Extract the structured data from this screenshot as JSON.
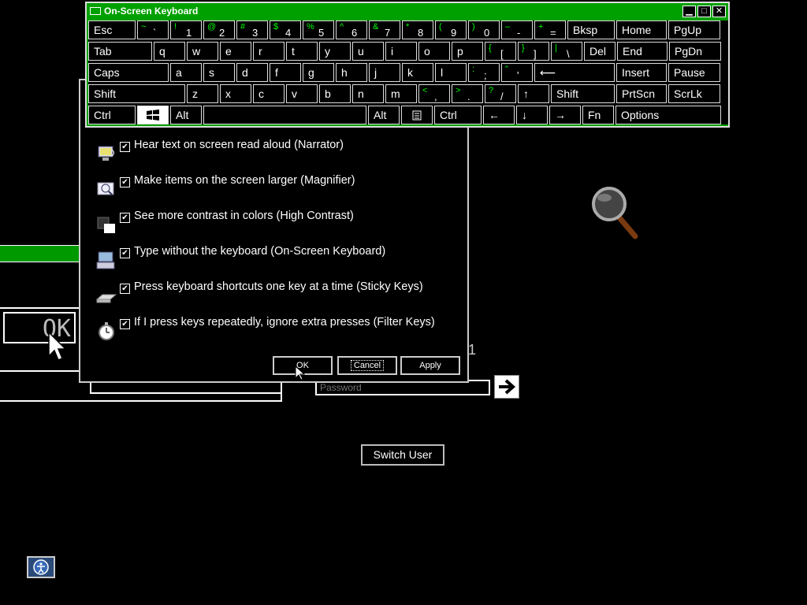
{
  "osk": {
    "title": "On-Screen Keyboard",
    "window_buttons": [
      "▁",
      "□",
      "✕"
    ],
    "rows": [
      [
        {
          "main": "Esc",
          "w": 60
        },
        {
          "shift": "~",
          "base": "`",
          "w": 40
        },
        {
          "shift": "!",
          "base": "1",
          "w": 40
        },
        {
          "shift": "@",
          "base": "2",
          "w": 40
        },
        {
          "shift": "#",
          "base": "3",
          "w": 40
        },
        {
          "shift": "$",
          "base": "4",
          "w": 40
        },
        {
          "shift": "%",
          "base": "5",
          "w": 40
        },
        {
          "shift": "^",
          "base": "6",
          "w": 40
        },
        {
          "shift": "&",
          "base": "7",
          "w": 40
        },
        {
          "shift": "*",
          "base": "8",
          "w": 40
        },
        {
          "shift": "(",
          "base": "9",
          "w": 40
        },
        {
          "shift": ")",
          "base": "0",
          "w": 40
        },
        {
          "shift": "–",
          "base": "-",
          "w": 40
        },
        {
          "shift": "+",
          "base": "=",
          "w": 40
        },
        {
          "main": "Bksp",
          "w": 60
        },
        {
          "main": "Home",
          "w": 64
        },
        {
          "main": "PgUp",
          "w": 66
        }
      ],
      [
        {
          "main": "Tab",
          "w": 81
        },
        {
          "main": "q",
          "w": 40
        },
        {
          "main": "w",
          "w": 40
        },
        {
          "main": "e",
          "w": 40
        },
        {
          "main": "r",
          "w": 40
        },
        {
          "main": "t",
          "w": 40
        },
        {
          "main": "y",
          "w": 40
        },
        {
          "main": "u",
          "w": 40
        },
        {
          "main": "i",
          "w": 40
        },
        {
          "main": "o",
          "w": 40
        },
        {
          "main": "p",
          "w": 40
        },
        {
          "shift": "{",
          "base": "[",
          "w": 40
        },
        {
          "shift": "}",
          "base": "]",
          "w": 40
        },
        {
          "shift": "|",
          "base": "\\",
          "w": 40
        },
        {
          "main": "Del",
          "w": 40
        },
        {
          "main": "End",
          "w": 64
        },
        {
          "main": "PgDn",
          "w": 66
        }
      ],
      [
        {
          "main": "Caps",
          "w": 102
        },
        {
          "main": "a",
          "w": 40
        },
        {
          "main": "s",
          "w": 40
        },
        {
          "main": "d",
          "w": 40
        },
        {
          "main": "f",
          "w": 40
        },
        {
          "main": "g",
          "w": 40
        },
        {
          "main": "h",
          "w": 40
        },
        {
          "main": "j",
          "w": 40
        },
        {
          "main": "k",
          "w": 40
        },
        {
          "main": "l",
          "w": 40
        },
        {
          "shift": ":",
          "base": ";",
          "w": 40
        },
        {
          "shift": "\"",
          "base": "'",
          "w": 40
        },
        {
          "main": "⟵",
          "w": 102
        },
        {
          "main": "Insert",
          "w": 64
        },
        {
          "main": "Pause",
          "w": 66
        }
      ],
      [
        {
          "main": "Shift",
          "w": 123
        },
        {
          "main": "z",
          "w": 40
        },
        {
          "main": "x",
          "w": 40
        },
        {
          "main": "c",
          "w": 40
        },
        {
          "main": "v",
          "w": 40
        },
        {
          "main": "b",
          "w": 40
        },
        {
          "main": "n",
          "w": 40
        },
        {
          "main": "m",
          "w": 40
        },
        {
          "shift": "<",
          "base": ",",
          "w": 40
        },
        {
          "shift": ">",
          "base": ".",
          "w": 40
        },
        {
          "shift": "?",
          "base": "/",
          "w": 40
        },
        {
          "main": "↑",
          "w": 40
        },
        {
          "main": "Shift",
          "w": 81
        },
        {
          "main": "PrtScn",
          "w": 64
        },
        {
          "main": "ScrLk",
          "w": 66
        }
      ],
      [
        {
          "main": "Ctrl",
          "w": 60
        },
        {
          "main": "",
          "icon": "windows-icon",
          "w": 40
        },
        {
          "main": "Alt",
          "w": 40
        },
        {
          "main": "",
          "w": 207
        },
        {
          "main": "Alt",
          "w": 40
        },
        {
          "main": "",
          "icon": "menu-icon",
          "w": 40
        },
        {
          "main": "Ctrl",
          "w": 60
        },
        {
          "main": "←",
          "w": 40
        },
        {
          "main": "↓",
          "w": 40
        },
        {
          "main": "→",
          "w": 40
        },
        {
          "main": "Fn",
          "w": 40
        },
        {
          "main": "Options",
          "w": 134
        }
      ]
    ]
  },
  "dialog": {
    "options": [
      {
        "label": "Hear text on screen read aloud (Narrator)",
        "icon": "narrator-icon",
        "checked": true
      },
      {
        "label": "Make items on the screen larger (Magnifier)",
        "icon": "magnifier-icon",
        "checked": true
      },
      {
        "label": "See more contrast in colors (High Contrast)",
        "icon": "high-contrast-icon",
        "checked": true
      },
      {
        "label": "Type without the keyboard (On-Screen Keyboard)",
        "icon": "keyboard-icon",
        "checked": true
      },
      {
        "label": "Press keyboard shortcuts one key at a time (Sticky Keys)",
        "icon": "sticky-keys-icon",
        "checked": true
      },
      {
        "label": "If I press keys repeatedly, ignore extra presses (Filter Keys)",
        "icon": "filter-keys-icon",
        "checked": true
      }
    ],
    "ok_label": "OK",
    "cancel_label": "Cancel",
    "apply_label": "Apply",
    "check_mark": "✔"
  },
  "logon": {
    "password_placeholder": "Password",
    "switch_user_label": "Switch User",
    "bg_ok_label": "OK",
    "go_arrow": "→"
  },
  "colors": {
    "accent": "#00a000",
    "shift_glyph": "#00ff00"
  }
}
